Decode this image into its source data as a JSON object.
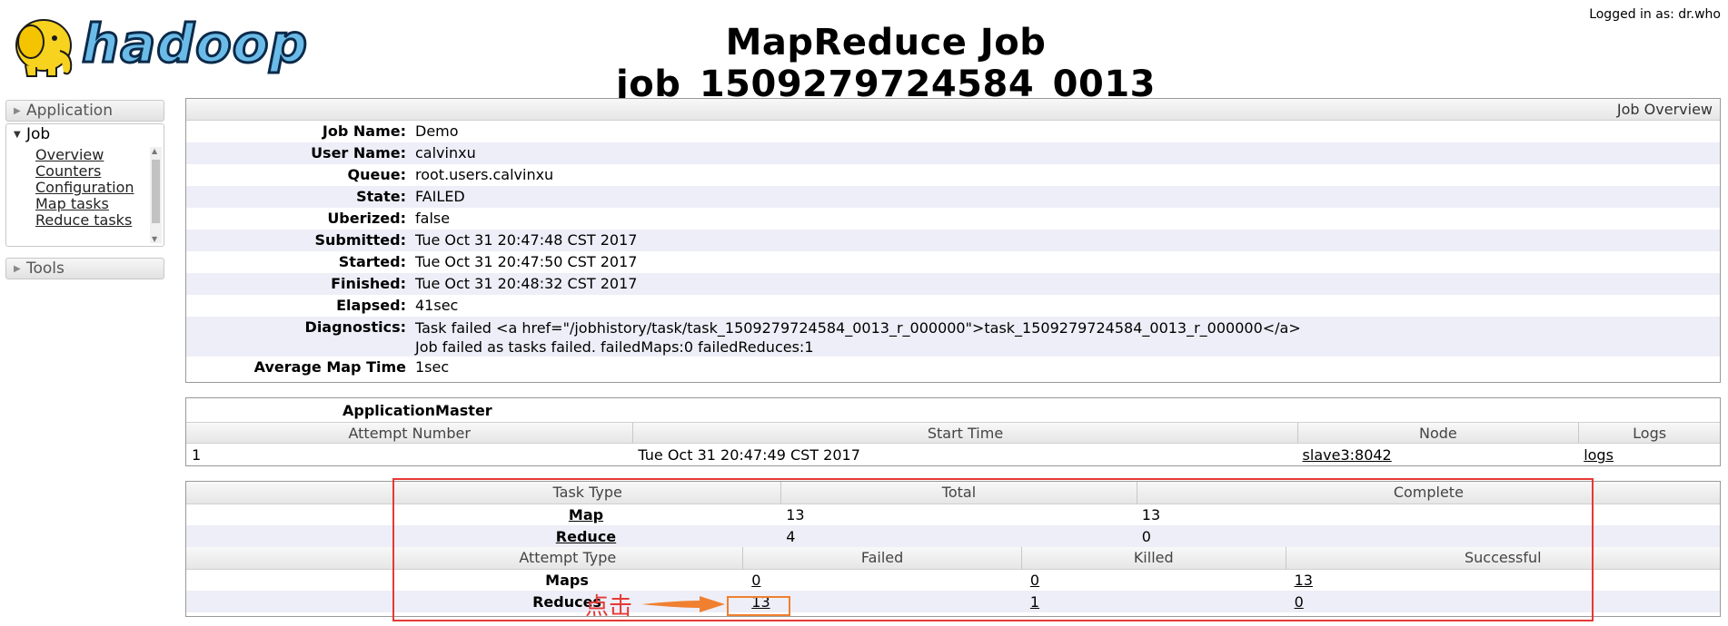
{
  "header": {
    "logo_text": "hadoop",
    "title": "MapReduce Job job_1509279724584_0013",
    "logged_in_label": "Logged in as:",
    "logged_in_user": "dr.who"
  },
  "nav": {
    "application_label": "Application",
    "job_label": "Job",
    "job_items": [
      "Overview",
      "Counters",
      "Configuration",
      "Map tasks",
      "Reduce tasks"
    ],
    "tools_label": "Tools"
  },
  "overview": {
    "heading": "Job Overview",
    "rows": [
      {
        "label": "Job Name:",
        "value": "Demo"
      },
      {
        "label": "User Name:",
        "value": "calvinxu"
      },
      {
        "label": "Queue:",
        "value": "root.users.calvinxu"
      },
      {
        "label": "State:",
        "value": "FAILED"
      },
      {
        "label": "Uberized:",
        "value": "false"
      },
      {
        "label": "Submitted:",
        "value": "Tue Oct 31 20:47:48 CST 2017"
      },
      {
        "label": "Started:",
        "value": "Tue Oct 31 20:47:50 CST 2017"
      },
      {
        "label": "Finished:",
        "value": "Tue Oct 31 20:48:32 CST 2017"
      },
      {
        "label": "Elapsed:",
        "value": "41sec"
      }
    ],
    "diagnostics_label": "Diagnostics:",
    "diagnostics_line1": "Task failed <a href=\"/jobhistory/task/task_1509279724584_0013_r_000000\">task_1509279724584_0013_r_000000</a>",
    "diagnostics_line2": "Job failed as tasks failed. failedMaps:0 failedReduces:1",
    "avg_map_label": "Average Map Time",
    "avg_map_value": "1sec"
  },
  "application_master": {
    "title": "ApplicationMaster",
    "columns": [
      "Attempt Number",
      "Start Time",
      "Node",
      "Logs"
    ],
    "row": {
      "attempt": "1",
      "start_time": "Tue Oct 31 20:47:49 CST 2017",
      "node": "slave3:8042",
      "logs": "logs"
    }
  },
  "tasks": {
    "task_columns": [
      "Task Type",
      "Total",
      "Complete"
    ],
    "task_rows": [
      {
        "type": "Map",
        "total": "13",
        "complete": "13"
      },
      {
        "type": "Reduce",
        "total": "4",
        "complete": "0"
      }
    ],
    "attempt_columns": [
      "Attempt Type",
      "Failed",
      "Killed",
      "Successful"
    ],
    "attempt_rows": [
      {
        "type": "Maps",
        "failed": "0",
        "killed": "0",
        "successful": "13"
      },
      {
        "type": "Reduces",
        "failed": "13",
        "killed": "1",
        "successful": "0"
      }
    ]
  },
  "annotation": {
    "text": "点击",
    "color_red": "#e53935",
    "color_orange": "#f08030"
  }
}
